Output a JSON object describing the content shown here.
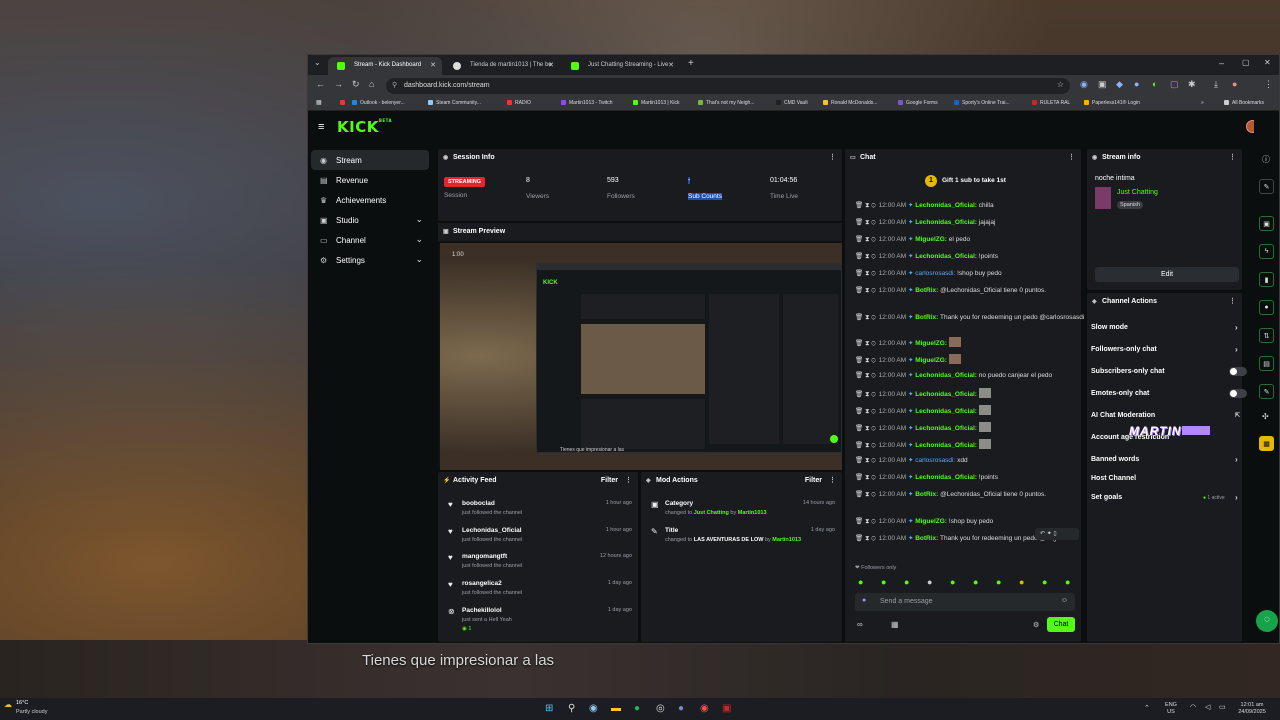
{
  "browser": {
    "tabs": [
      {
        "label": "Stream - Kick Dashboard",
        "color": "#53fc18"
      },
      {
        "label": "Tienda de martin1013 | The be",
        "color": "#dddddd"
      },
      {
        "label": "Just Chatting Streaming - Live",
        "color": "#53fc18"
      }
    ],
    "url": "dashboard.kick.com/stream",
    "bookmarks": [
      "Outlook - belenyer...",
      "Steam Community...",
      "RADIO",
      "Martin1013 - Twitch",
      "Martin1013 | Kick",
      "That's not my Neigh...",
      "CMD Vault",
      "Ronald McDonalds...",
      "Google Forms",
      "Sporty's Online Trai...",
      "RULETA RAL",
      "Paperless141® Login"
    ],
    "all_bookmarks": "All Bookmarks"
  },
  "app": {
    "logo": "KICK",
    "logo_beta": "BETA",
    "nav": [
      {
        "label": "Stream",
        "icon": "stream-icon",
        "active": true,
        "chevron": false
      },
      {
        "label": "Revenue",
        "icon": "revenue-icon",
        "active": false,
        "chevron": false
      },
      {
        "label": "Achievements",
        "icon": "trophy-icon",
        "active": false,
        "chevron": false
      },
      {
        "label": "Studio",
        "icon": "studio-icon",
        "active": false,
        "chevron": true
      },
      {
        "label": "Channel",
        "icon": "channel-icon",
        "active": false,
        "chevron": true
      },
      {
        "label": "Settings",
        "icon": "gear-icon",
        "active": false,
        "chevron": true
      }
    ]
  },
  "session": {
    "title": "Session Info",
    "status": "STREAMING",
    "status_label": "Session",
    "viewers": "8",
    "viewers_label": "Viewers",
    "followers": "593",
    "followers_label": "Followers",
    "subs": "-",
    "subs_label": "Sub Counts",
    "time": "01:04:56",
    "time_label": "Time Live"
  },
  "preview": {
    "title": "Stream Preview",
    "timer": "1:00",
    "caption": "Tienes que impresionar a las"
  },
  "activity": {
    "title": "Activity Feed",
    "filter": "Filter",
    "items": [
      {
        "name": "booboclad",
        "desc": "just followed the channel",
        "time": "1 hour ago"
      },
      {
        "name": "Lechonidas_Oficial",
        "desc": "just followed the channel",
        "time": "1 hour ago"
      },
      {
        "name": "mangomangtft",
        "desc": "just followed the channel",
        "time": "12 hours ago"
      },
      {
        "name": "rosangelica2",
        "desc": "just followed the channel",
        "time": "1 day ago"
      },
      {
        "name": "Pachekillolol",
        "desc": "just sent a Hell Yeah",
        "time": "1 day ago",
        "extra": "1"
      }
    ]
  },
  "mod": {
    "title": "Mod Actions",
    "filter": "Filter",
    "items": [
      {
        "title": "Category",
        "desc_pre": "changed to",
        "value": "Just Chatting",
        "by": "by",
        "user": "Martin1013",
        "time": "14 hours ago"
      },
      {
        "title": "Title",
        "desc_pre": "changed to",
        "value": "LAS AVENTURAS DE LOW",
        "by": "by",
        "user": "Martin1013",
        "time": "1 day ago"
      }
    ]
  },
  "chat": {
    "title": "Chat",
    "gift_num": "1",
    "gift": "Gift 1 sub to take 1st",
    "messages": [
      {
        "time": "12:00 AM",
        "user": "Lechonidas_Oficial:",
        "cls": "uG",
        "text": "chilla"
      },
      {
        "time": "12:00 AM",
        "user": "Lechonidas_Oficial:",
        "cls": "uG",
        "text": "jajajaj"
      },
      {
        "time": "12:00 AM",
        "user": "MiguelZG:",
        "cls": "uG",
        "text": "el pedo"
      },
      {
        "time": "12:00 AM",
        "user": "Lechonidas_Oficial:",
        "cls": "uG",
        "text": "!points"
      },
      {
        "time": "12:00 AM",
        "user": "carlosrosasdi:",
        "cls": "uB",
        "text": "!shop buy pedo"
      },
      {
        "time": "12:00 AM",
        "user": "BotRix:",
        "cls": "bot",
        "text": "@Lechonidas_Oficial tiene 0 puntos."
      },
      {
        "time": "12:00 AM",
        "user": "BotRix:",
        "cls": "bot",
        "text": "Thank you for redeeming un pedo @carlosrosasdi"
      },
      {
        "time": "12:00 AM",
        "user": "MiguelZG:",
        "cls": "uG",
        "text": "",
        "emote": "r"
      },
      {
        "time": "12:00 AM",
        "user": "MiguelZG:",
        "cls": "uG",
        "text": "",
        "emote": "r"
      },
      {
        "time": "12:00 AM",
        "user": "Lechonidas_Oficial:",
        "cls": "uG",
        "text": "no puedo canjear el pedo"
      },
      {
        "time": "12:00 AM",
        "user": "Lechonidas_Oficial:",
        "cls": "uG",
        "text": "",
        "emote": "g"
      },
      {
        "time": "12:00 AM",
        "user": "Lechonidas_Oficial:",
        "cls": "uG",
        "text": "",
        "emote": "g"
      },
      {
        "time": "12:00 AM",
        "user": "Lechonidas_Oficial:",
        "cls": "uG",
        "text": "",
        "emote": "g"
      },
      {
        "time": "12:00 AM",
        "user": "Lechonidas_Oficial:",
        "cls": "uG",
        "text": "",
        "emote": "g"
      },
      {
        "time": "12:00 AM",
        "user": "carlosrosasdi:",
        "cls": "uB",
        "text": "xdd"
      },
      {
        "time": "12:00 AM",
        "user": "Lechonidas_Oficial:",
        "cls": "uG",
        "text": "!points"
      },
      {
        "time": "12:00 AM",
        "user": "BotRix:",
        "cls": "bot",
        "text": "@Lechonidas_Oficial tiene 0 puntos."
      },
      {
        "time": "12:00 AM",
        "user": "MiguelZG:",
        "cls": "uG",
        "text": "!shop buy pedo"
      },
      {
        "time": "12:00 AM",
        "user": "BotRix:",
        "cls": "bot",
        "text": "Thank you for redeeming un pedo @MiguelZG"
      }
    ],
    "mode": "Followers only",
    "placeholder": "Send a message",
    "send": "Chat"
  },
  "stream_info": {
    "title": "Stream info",
    "stream_title": "noche intima",
    "category": "Just Chatting",
    "language": "Spanish",
    "edit": "Edit"
  },
  "channel_actions": {
    "title": "Channel Actions",
    "items": [
      {
        "label": "Slow mode",
        "control": "chevron"
      },
      {
        "label": "Followers-only chat",
        "control": "chevron"
      },
      {
        "label": "Subscribers-only chat",
        "control": "toggle"
      },
      {
        "label": "Emotes-only chat",
        "control": "toggle"
      },
      {
        "label": "AI Chat Moderation",
        "control": "external"
      },
      {
        "label": "Account age restriction",
        "control": "chevron"
      },
      {
        "label": "Banned words",
        "control": "chevron"
      },
      {
        "label": "Host Channel",
        "control": "none"
      },
      {
        "label": "Set goals",
        "control": "chevron",
        "status": "1 active"
      }
    ],
    "watermark": "MARTIN"
  },
  "taskbar": {
    "weather_temp": "16°C",
    "weather_desc": "Partly cloudy",
    "lang1": "ENG",
    "lang2": "US",
    "time": "12:01 am",
    "date": "24/09/2025"
  }
}
